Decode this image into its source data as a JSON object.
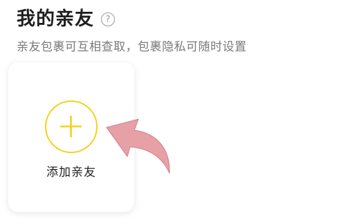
{
  "header": {
    "title": "我的亲友",
    "help_glyph": "?",
    "subtitle": "亲友包裹可互相查取，包裹隐私可随时设置"
  },
  "card": {
    "add_label": "添加亲友",
    "icon": "plus-icon"
  },
  "colors": {
    "accent": "#f2d21a",
    "arrow": "#e7a0a6"
  }
}
